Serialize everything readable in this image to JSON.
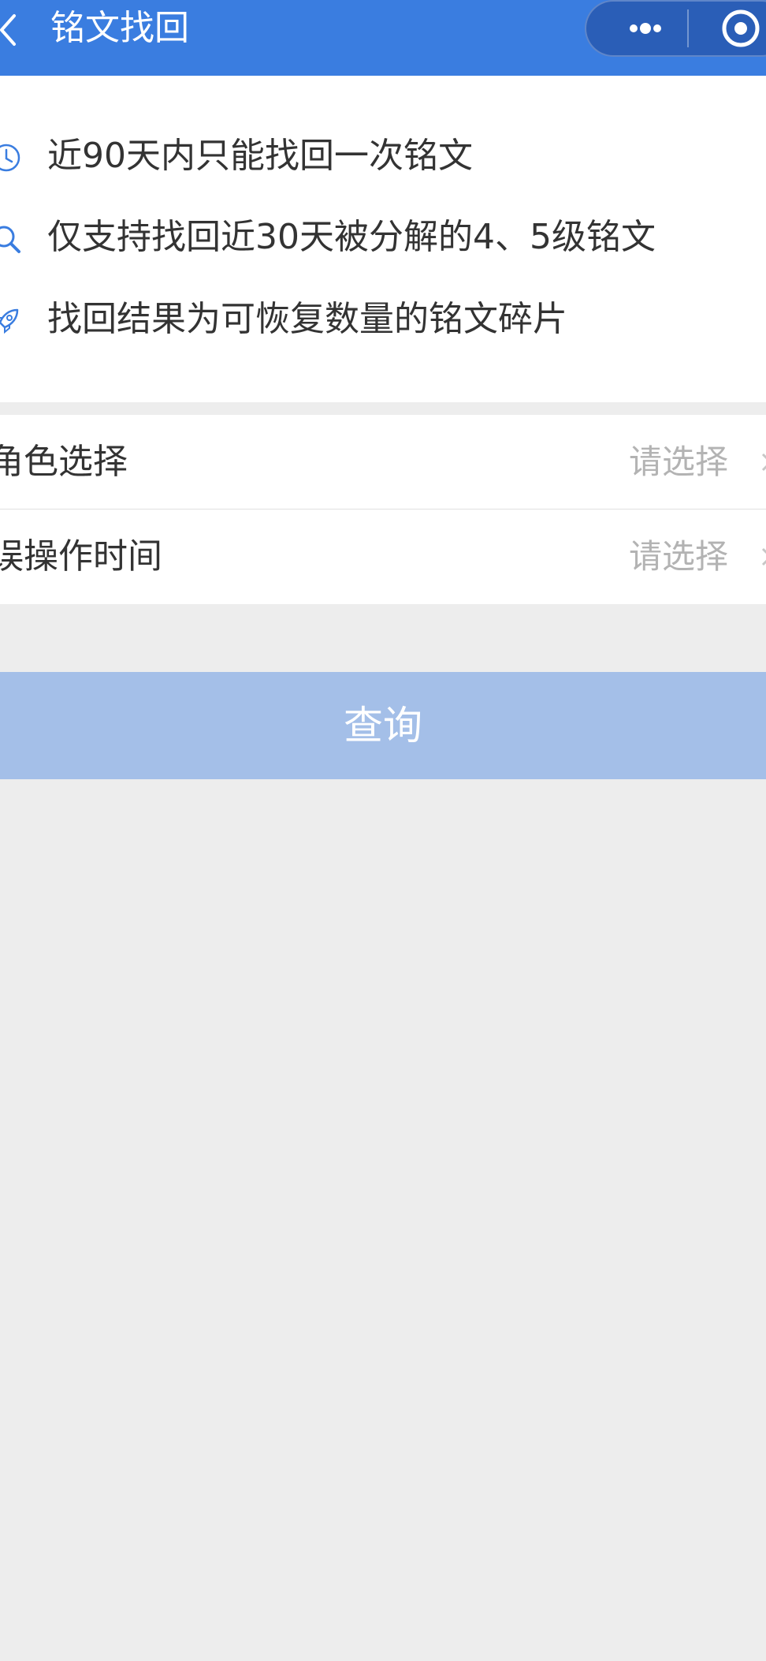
{
  "navbar": {
    "title": "铭文找回",
    "back_icon": "chevron-left-icon",
    "more_icon": "more-dots-icon",
    "close_icon": "target-circle-icon",
    "background": "#3a7de0"
  },
  "notice": {
    "items": [
      {
        "icon": "clock-icon",
        "text": "近90天内只能找回一次铭文"
      },
      {
        "icon": "search-icon",
        "text": "仅支持找回近30天被分解的4、5级铭文"
      },
      {
        "icon": "rocket-icon",
        "text": "找回结果为可恢复数量的铭文碎片"
      }
    ],
    "icon_color": "#3a7de0"
  },
  "form": {
    "rows": [
      {
        "label": "角色选择",
        "placeholder": "请选择"
      },
      {
        "label": "误操作时间",
        "placeholder": "请选择"
      }
    ]
  },
  "query_button": {
    "label": "查询",
    "state": "disabled",
    "color": "#a4bfe8"
  }
}
